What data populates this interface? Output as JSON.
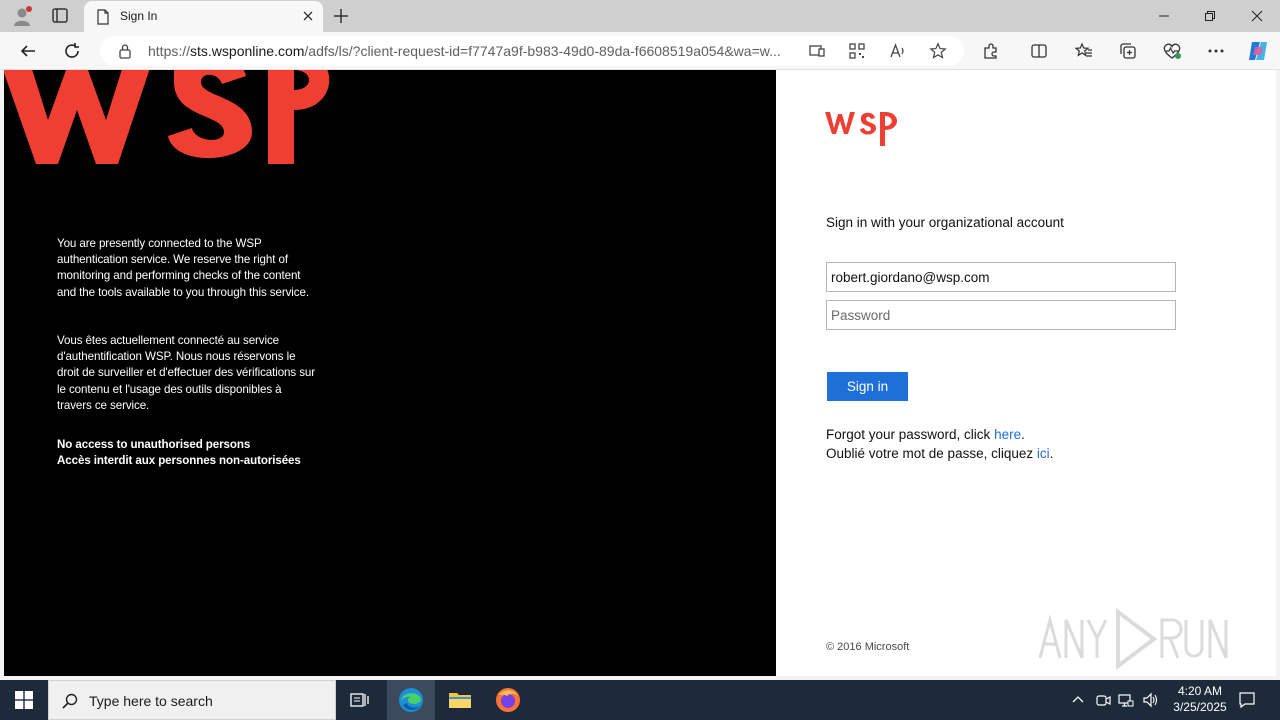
{
  "browser": {
    "tab_title": "Sign In",
    "url_prefix": "https://",
    "url_host": "sts.wsponline.com",
    "url_rest": "/adfs/ls/?client-request-id=f7747a9f-b983-49d0-89da-f6608519a054&wa=w..."
  },
  "left": {
    "notice_en": "You are presently connected to the WSP authentication service. We reserve the right of monitoring and performing checks of the content and the tools available to you through this service.",
    "notice_fr": "Vous êtes actuellement connecté au service d'authentification WSP. Nous nous réservons le droit de surveiller et d'effectuer des vérifications sur le contenu et l'usage des outils disponibles à travers ce service.",
    "warning_en": "No access to unauthorised persons",
    "warning_fr": "Accès interdit aux personnes non-autorisées",
    "brand_color": "#ef3e32"
  },
  "form": {
    "heading": "Sign in with your organizational account",
    "username_value": "robert.giordano@wsp.com",
    "password_placeholder": "Password",
    "signin_label": "Sign in",
    "forgot_en_prefix": "Forgot your password, click ",
    "forgot_en_link": "here",
    "forgot_en_suffix": ".",
    "forgot_fr_prefix": "Oublié votre mot de passe, cliquez ",
    "forgot_fr_link": "ici",
    "forgot_fr_suffix": ".",
    "copyright": "© 2016 Microsoft",
    "accent_color": "#1f6fd8"
  },
  "taskbar": {
    "search_placeholder": "Type here to search",
    "time": "4:20 AM",
    "date": "3/25/2025"
  }
}
